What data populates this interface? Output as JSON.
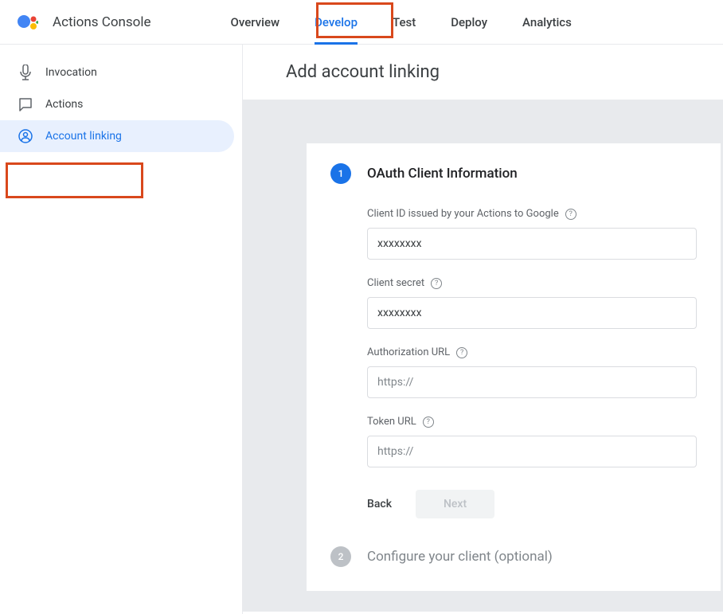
{
  "header": {
    "app_title": "Actions Console",
    "tabs": [
      {
        "label": "Overview"
      },
      {
        "label": "Develop"
      },
      {
        "label": "Test"
      },
      {
        "label": "Deploy"
      },
      {
        "label": "Analytics"
      }
    ]
  },
  "sidebar": {
    "items": [
      {
        "label": "Invocation",
        "icon": "mic"
      },
      {
        "label": "Actions",
        "icon": "chat"
      },
      {
        "label": "Account linking",
        "icon": "person"
      }
    ]
  },
  "page": {
    "title": "Add account linking",
    "step1": {
      "number": "1",
      "title": "OAuth Client Information",
      "fields": {
        "client_id": {
          "label": "Client ID issued by your Actions to Google",
          "value": "xxxxxxxx"
        },
        "client_secret": {
          "label": "Client secret",
          "value": "xxxxxxxx"
        },
        "auth_url": {
          "label": "Authorization URL",
          "placeholder": "https://"
        },
        "token_url": {
          "label": "Token URL",
          "placeholder": "https://"
        }
      },
      "buttons": {
        "back": "Back",
        "next": "Next"
      }
    },
    "step2": {
      "number": "2",
      "title": "Configure your client (optional)"
    }
  }
}
